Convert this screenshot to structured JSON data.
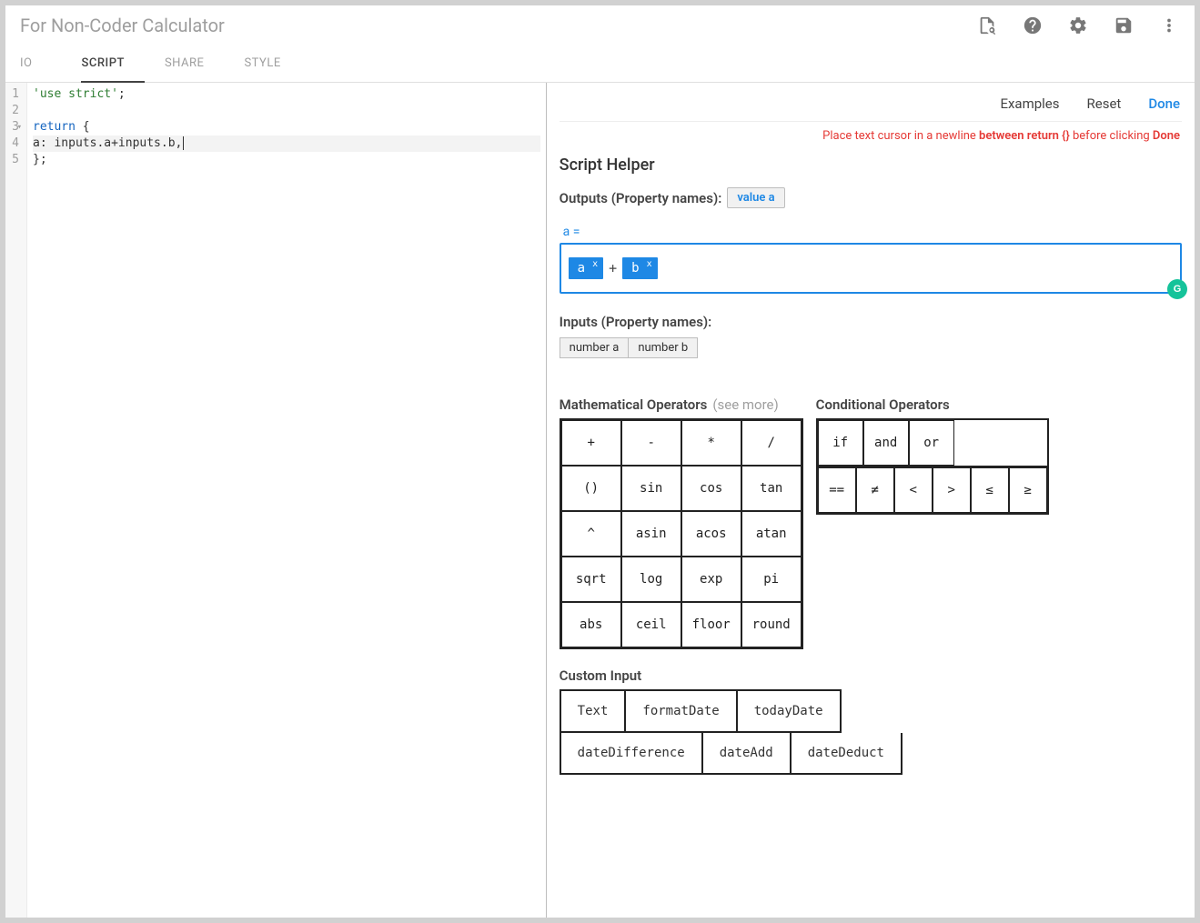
{
  "title": "For Non-Coder Calculator",
  "tabs": [
    "IO",
    "SCRIPT",
    "SHARE",
    "STYLE"
  ],
  "activeTab": "SCRIPT",
  "code": {
    "lines": [
      {
        "n": "1",
        "segments": [
          {
            "cls": "str",
            "t": "'use strict'"
          },
          {
            "cls": "",
            "t": ";"
          }
        ]
      },
      {
        "n": "2",
        "segments": []
      },
      {
        "n": "3",
        "fold": true,
        "segments": [
          {
            "cls": "kw",
            "t": "return"
          },
          {
            "cls": "",
            "t": " {"
          }
        ]
      },
      {
        "n": "4",
        "active": true,
        "segments": [
          {
            "cls": "prop",
            "t": "a"
          },
          {
            "cls": "",
            "t": ": inputs.a+inputs.b,"
          }
        ],
        "cursor": true
      },
      {
        "n": "5",
        "segments": [
          {
            "cls": "",
            "t": "};"
          }
        ]
      }
    ]
  },
  "helperLinks": {
    "examples": "Examples",
    "reset": "Reset",
    "done": "Done"
  },
  "hint": {
    "pre": "Place text cursor in a newline ",
    "bold1": "between return {}",
    "mid": " before clicking ",
    "bold2": "Done"
  },
  "scriptHelperTitle": "Script Helper",
  "outputsLabel": "Outputs (Property names):",
  "outputChips": [
    "value a"
  ],
  "eqLabel": "a =",
  "exprTokens": [
    {
      "type": "token",
      "text": "a"
    },
    {
      "type": "op",
      "text": "+"
    },
    {
      "type": "token",
      "text": "b"
    }
  ],
  "inputsLabel": "Inputs (Property names):",
  "inputChips": [
    "number a",
    "number b"
  ],
  "mathLabel": "Mathematical Operators",
  "mathMore": "(see more)",
  "mathOps": [
    "+",
    "-",
    "*",
    "/",
    "()",
    "sin",
    "cos",
    "tan",
    "^",
    "asin",
    "acos",
    "atan",
    "sqrt",
    "log",
    "exp",
    "pi",
    "abs",
    "ceil",
    "floor",
    "round"
  ],
  "condLabel": "Conditional Operators",
  "condTop": [
    "if",
    "and",
    "or"
  ],
  "condBot": [
    "==",
    "≠",
    "<",
    ">",
    "≤",
    "≥"
  ],
  "customLabel": "Custom Input",
  "customRow1": [
    "Text",
    "formatDate",
    "todayDate"
  ],
  "customRow2": [
    "dateDifference",
    "dateAdd",
    "dateDeduct"
  ]
}
